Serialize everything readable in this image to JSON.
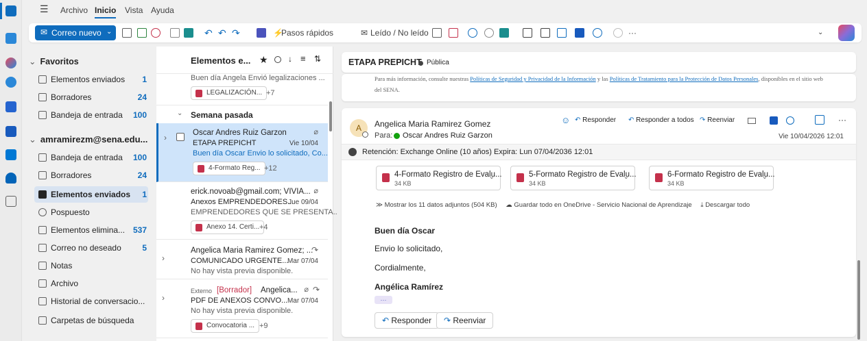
{
  "menubar": {
    "file": "Archivo",
    "home": "Inicio",
    "view": "Vista",
    "help": "Ayuda"
  },
  "toolbar": {
    "new_mail": "Correo nuevo",
    "quick_steps": "Pasos rápidos",
    "read_unread": "Leído / No leído",
    "overflow": "···"
  },
  "folders": {
    "favorites_header": "Favoritos",
    "favorites": [
      {
        "label": "Elementos enviados",
        "count": "1"
      },
      {
        "label": "Borradores",
        "count": "24"
      },
      {
        "label": "Bandeja de entrada",
        "count": "100"
      }
    ],
    "account": "amramirezm@sena.edu...",
    "items": [
      {
        "label": "Bandeja de entrada",
        "count": "100"
      },
      {
        "label": "Borradores",
        "count": "24"
      },
      {
        "label": "Elementos enviados",
        "count": "1"
      },
      {
        "label": "Pospuesto",
        "count": ""
      },
      {
        "label": "Elementos elimina...",
        "count": "537"
      },
      {
        "label": "Correo no deseado",
        "count": "5"
      },
      {
        "label": "Notas",
        "count": ""
      },
      {
        "label": "Archivo",
        "count": ""
      },
      {
        "label": "Historial de conversacio...",
        "count": ""
      },
      {
        "label": "Carpetas de búsqueda",
        "count": ""
      }
    ]
  },
  "list": {
    "header": "Elementos e...",
    "top_preview": "Buen día Angela Envió legalizaciones ...",
    "top_chip": "LEGALIZACIÓN...",
    "top_chip_more": "+7",
    "group": "Semana pasada",
    "messages": [
      {
        "from": "Oscar Andres Ruiz Garzon",
        "subject": "ETAPA PREPICHT",
        "date": "Vie 10/04",
        "preview": "Buen día Oscar Envio lo solicitado, Co...",
        "chip": "4-Formato Reg...",
        "more": "+12"
      },
      {
        "from": "erick.novoab@gmail.com; VIVIA...",
        "subject": "Anexos EMPRENDEDORES...",
        "date": "Jue 09/04",
        "preview": "EMPRENDEDORES QUE SE PRESENTA...",
        "chip": "Anexo 14. Certi...",
        "more": "+4"
      },
      {
        "from": "Angelica Maria Ramirez Gomez; ...",
        "subject": "COMUNICADO URGENTE...",
        "date": "Mar 07/04",
        "preview": "No hay vista previa disponible."
      },
      {
        "tag": "Externo",
        "draft": "[Borrador]",
        "from": "Angelica...",
        "subject": "PDF DE ANEXOS CONVO...",
        "date": "Mar 07/04",
        "preview": "No hay vista previa disponible.",
        "chip": "Convocatoria ...",
        "more": "+9"
      }
    ]
  },
  "reading": {
    "subject": "ETAPA PREPICHT",
    "visibility": "Pública",
    "policy_prefix": "Para más información, consulte nuestras",
    "policy_link1": "Políticas de Seguridad y Privacidad de la Información",
    "policy_mid": "y las",
    "policy_link2": "Políticas de Tratamiento para la Protección de Datos Personales",
    "policy_suffix": ", disponibles en el sitio web",
    "policy_line2": "del SENA.",
    "avatar": "A",
    "sender": "Angelica Maria Ramirez Gomez",
    "to_label": "Para:",
    "to": "Oscar Andres Ruiz Garzon",
    "datetime": "Vie 10/04/2026 12:01",
    "reply": "Responder",
    "reply_all": "Responder a todos",
    "forward": "Reenviar",
    "retention": "Retención: Exchange Online (10 años) Expira: Lun 07/04/2036 12:01",
    "attachments": [
      {
        "name": "4-Formato Registro de Evalu...",
        "size": "34 KB"
      },
      {
        "name": "5-Formato Registro de Evalu...",
        "size": "34 KB"
      },
      {
        "name": "6-Formato Registro de Evalu...",
        "size": "34 KB"
      }
    ],
    "show_all": "Mostrar los 11 datos adjuntos (504 KB)",
    "save_all": "Guardar todo en OneDrive - Servicio Nacional de Aprendizaje",
    "download_all": "Descargar todo",
    "body": [
      "Buen día Oscar",
      "Envio lo solicitado,",
      "Cordialmente,",
      "Angélica Ramírez"
    ],
    "ellipsis": "···",
    "btn_reply": "Responder",
    "btn_forward": "Reenviar"
  },
  "colors": {
    "accent": "#0f6cbd",
    "selected": "#cfe4fa",
    "pdf": "#c4314b",
    "link": "#0f6cbd"
  }
}
